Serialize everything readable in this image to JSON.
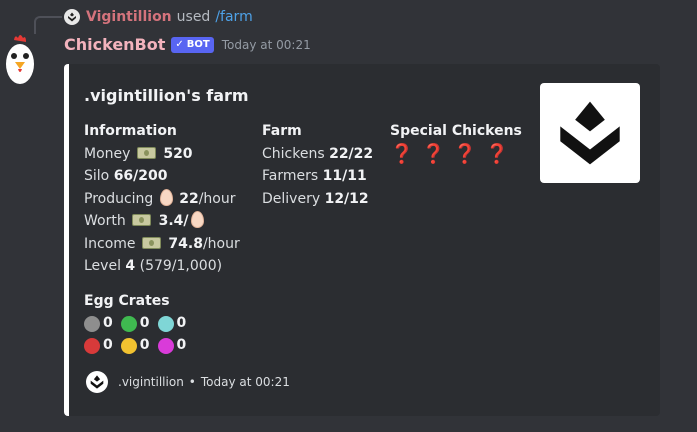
{
  "reply": {
    "username": "Vigintillion",
    "used_text": "used",
    "command": "/farm"
  },
  "message": {
    "bot_name": "ChickenBot",
    "badge": "BOT",
    "timestamp": "Today at 00:21"
  },
  "embed": {
    "title": ".vigintillion's farm",
    "accent_color": "#ffffff",
    "fields": {
      "information": {
        "name": "Information",
        "money_label": "Money",
        "money_value": "520",
        "silo_label": "Silo",
        "silo_value": "66/200",
        "producing_label": "Producing",
        "producing_value": "22",
        "producing_unit": "/hour",
        "worth_label": "Worth",
        "worth_value": "3.4/",
        "income_label": "Income",
        "income_value": "74.8",
        "income_unit": "/hour",
        "level_label": "Level",
        "level_value": "4",
        "level_progress": "(579/1,000)"
      },
      "farm": {
        "name": "Farm",
        "chickens_label": "Chickens",
        "chickens_value": "22/22",
        "farmers_label": "Farmers",
        "farmers_value": "11/11",
        "delivery_label": "Delivery",
        "delivery_value": "12/12"
      },
      "special_chickens": {
        "name": "Special Chickens",
        "slots": [
          "❓",
          "❓",
          "❓",
          "❓"
        ]
      },
      "egg_crates": {
        "name": "Egg Crates",
        "crates": [
          {
            "icon": "gray-crate-icon",
            "color": "#8e8e8e",
            "count": "0"
          },
          {
            "icon": "green-crate-icon",
            "color": "#3fb950",
            "count": "0"
          },
          {
            "icon": "teal-crate-icon",
            "color": "#7fd6d6",
            "count": "0"
          },
          {
            "icon": "red-crate-icon",
            "color": "#d83a3a",
            "count": "0"
          },
          {
            "icon": "yellow-crate-icon",
            "color": "#f2c230",
            "count": "0"
          },
          {
            "icon": "magenta-crate-icon",
            "color": "#d93bd9",
            "count": "0"
          }
        ]
      }
    },
    "footer": {
      "author": ".vigintillion",
      "separator": "•",
      "timestamp": "Today at 00:21"
    }
  }
}
